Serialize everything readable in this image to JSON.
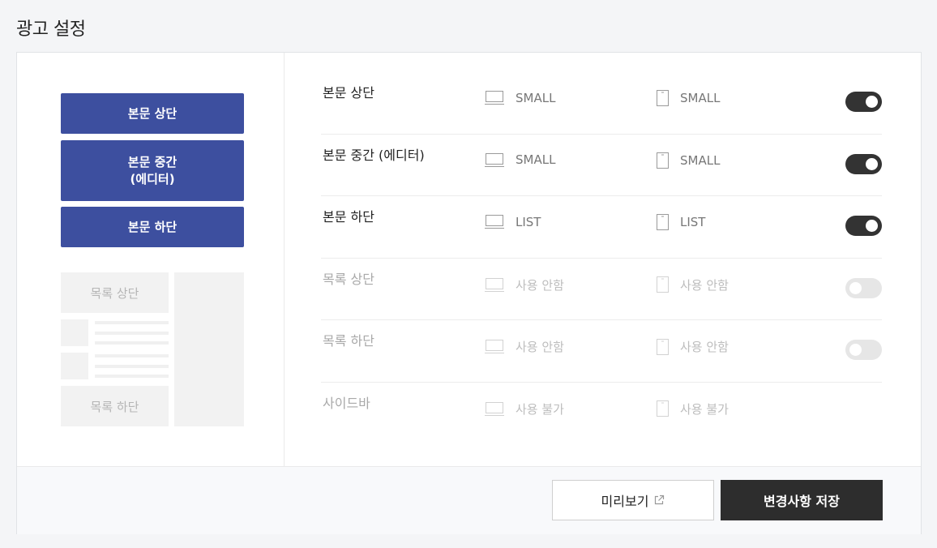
{
  "page": {
    "title": "광고 설정"
  },
  "preview": {
    "blocks": [
      {
        "label": "본문 상단"
      },
      {
        "label": "본문 중간\n(에디터)"
      },
      {
        "label": "본문 하단"
      }
    ],
    "ghost_list_top": "목록 상단",
    "ghost_list_bottom": "목록 하단"
  },
  "rows": [
    {
      "label": "본문 상단",
      "pc": "SMALL",
      "mobile": "SMALL",
      "enabled": true,
      "toggle": true
    },
    {
      "label": "본문 중간 (에디터)",
      "pc": "SMALL",
      "mobile": "SMALL",
      "enabled": true,
      "toggle": true
    },
    {
      "label": "본문 하단",
      "pc": "LIST",
      "mobile": "LIST",
      "enabled": true,
      "toggle": true
    },
    {
      "label": "목록 상단",
      "pc": "사용 안함",
      "mobile": "사용 안함",
      "enabled": false,
      "toggle": true
    },
    {
      "label": "목록 하단",
      "pc": "사용 안함",
      "mobile": "사용 안함",
      "enabled": false,
      "toggle": true
    },
    {
      "label": "사이드바",
      "pc": "사용 불가",
      "mobile": "사용 불가",
      "enabled": false,
      "toggle": false
    }
  ],
  "footer": {
    "preview_label": "미리보기",
    "save_label": "변경사항 저장"
  },
  "colors": {
    "accent": "#3d4f9f",
    "toggle_on": "#333333",
    "toggle_off": "#e6e6e6",
    "save_bg": "#2d2d2d"
  },
  "icons": {
    "pc": "monitor-icon",
    "mobile": "phone-icon",
    "external": "external-link-icon"
  }
}
